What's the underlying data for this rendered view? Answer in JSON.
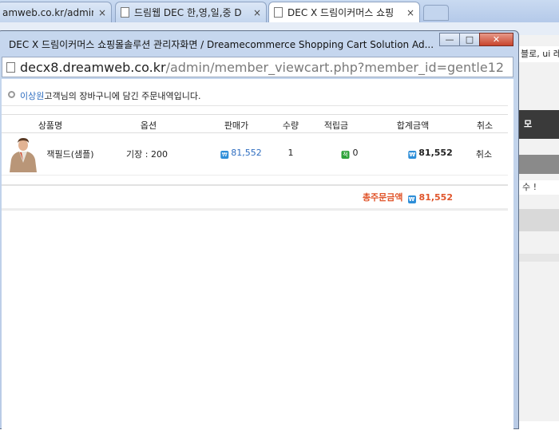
{
  "browser": {
    "tabs": [
      {
        "title": "amweb.co.kr/admin/C",
        "active": false
      },
      {
        "title": "드림웹 DEC 한,영,일,중 D",
        "active": false
      },
      {
        "title": "DEC X 드림이커머스 쇼핑",
        "active": true
      }
    ],
    "tab_close": "×",
    "bg_snippets": {
      "s1": "블로, ui 레",
      "s2": "모",
      "s4": "수 !"
    }
  },
  "popup": {
    "title": "DEC X 드림이커머스 쇼핑몰솔루션 관리자화면 / Dreamecommerce Shopping Cart Solution Ad...",
    "buttons": {
      "minimize": "—",
      "maximize": "□",
      "close": "✕"
    },
    "url_host": "decx8.dreamweb.co.kr",
    "url_path": "/admin/member_viewcart.php?member_id=gentle12"
  },
  "notice": {
    "customer_name": "이상원",
    "suffix": "고객님의 장바구니에 담긴 주문내역입니다."
  },
  "table": {
    "headers": {
      "product": "상품명",
      "option": "옵션",
      "price": "판매가",
      "qty": "수량",
      "points": "적립금",
      "subtotal": "합계금액",
      "cancel": "취소"
    },
    "row": {
      "product": "잭필드(샘플)",
      "option": "기장 : 200",
      "price": "81,552",
      "qty": "1",
      "points": "0",
      "subtotal": "81,552",
      "cancel": "취소"
    }
  },
  "icons": {
    "won": "₩",
    "point": "적"
  },
  "total": {
    "label": "총주문금액",
    "value": "81,552"
  },
  "colors": {
    "link": "#2e6dc0",
    "total": "#e0552b",
    "won_badge": "#2e8ed8",
    "point_badge": "#2ea33a"
  }
}
